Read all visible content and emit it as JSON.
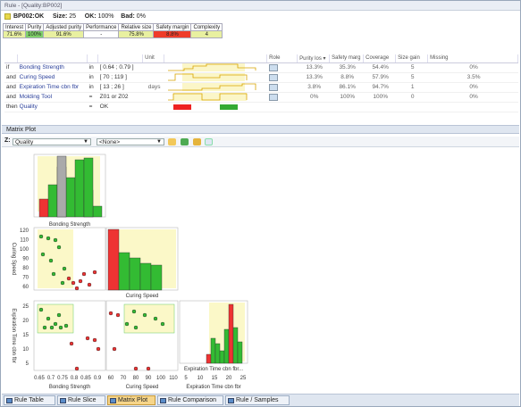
{
  "window": {
    "title": "Rule - [Quality:BP002]"
  },
  "header": {
    "rule_id": "BP002:OK",
    "size_label": "Size:",
    "size": "25",
    "ok_label": "OK:",
    "ok": "100%",
    "bad_label": "Bad:",
    "bad": "0%"
  },
  "metrics": {
    "headers": [
      "Interest",
      "Purity",
      "Adjusted purity",
      "Performance",
      "Relative size",
      "Safety margin",
      "Complexity"
    ],
    "values": [
      "71.6%",
      "100%",
      "91.6%",
      "-",
      "75.8%",
      "8.8%",
      "4"
    ],
    "colors": [
      "#e8f0a0",
      "#7fd16a",
      "#e8f0a0",
      "#ffffff",
      "#e8f0a0",
      "#ef3c2a",
      "#e8f0a0"
    ]
  },
  "rules_table": {
    "headers": {
      "unit": "Unit",
      "role": "Role",
      "purity_loss": "Purity los ▾",
      "safety_margin": "Safety marg",
      "coverage": "Coverage",
      "size_gain": "Size gain",
      "missing": "Missing"
    },
    "rows": [
      {
        "kw": "if",
        "var": "Bonding Strength",
        "op": "in",
        "range": "[ 0.64 ; 0.79 ]",
        "unit": "",
        "purity": "13.3%",
        "safety": "35.3%",
        "coverage": "54.4%",
        "gain": "5",
        "missing": "0%"
      },
      {
        "kw": "and",
        "var": "Curing Speed",
        "op": "in",
        "range": "[ 70 ; 119 ]",
        "unit": "",
        "purity": "13.3%",
        "safety": "8.8%",
        "coverage": "57.9%",
        "gain": "5",
        "missing": "3.5%"
      },
      {
        "kw": "and",
        "var": "Expiration Time cbn fbr",
        "op": "in",
        "range": "[ 13 ; 26 ]",
        "unit": "days",
        "purity": "3.8%",
        "safety": "86.1%",
        "coverage": "94.7%",
        "gain": "1",
        "missing": "0%"
      },
      {
        "kw": "and",
        "var": "Molding Tool",
        "op": "=",
        "range": "Z01 or Z02",
        "unit": "",
        "purity": "0%",
        "safety": "100%",
        "coverage": "100%",
        "gain": "0",
        "missing": "0%"
      },
      {
        "kw": "then",
        "var": "Quality",
        "op": "=",
        "range": "OK",
        "unit": "",
        "purity": "",
        "safety": "",
        "coverage": "",
        "gain": "",
        "missing": ""
      }
    ]
  },
  "matrix": {
    "section_title": "Matrix Plot",
    "z_label": "Z:",
    "z_value": "Quality",
    "color_value": "<None>",
    "diag_labels": [
      "Bonding Strength",
      "Curing Speed",
      "Expiration Time cbn fbr..."
    ],
    "left_labels": [
      "Curing Speed",
      "Expiration Time cbn fbr"
    ],
    "bottom_labels": [
      "Bonding Strength",
      "Curing Speed",
      "Expiration Time cbn fbr"
    ],
    "y_ticks_cs": [
      "120",
      "110",
      "100",
      "90",
      "80",
      "70",
      "60"
    ],
    "y_ticks_et": [
      "25",
      "20",
      "15",
      "10",
      "5"
    ],
    "x_ticks_bs": [
      "0.65",
      "0.7",
      "0.75",
      "0.8",
      "0.85",
      "0.9"
    ],
    "x_ticks_cs": [
      "60",
      "70",
      "80",
      "90",
      "100",
      "110"
    ],
    "x_ticks_et": [
      "5",
      "10",
      "15",
      "20",
      "25"
    ]
  },
  "tabs": [
    "Rule Table",
    "Rule Slice",
    "Matrix Plot",
    "Rule Comparison",
    "Rule / Samples"
  ]
}
